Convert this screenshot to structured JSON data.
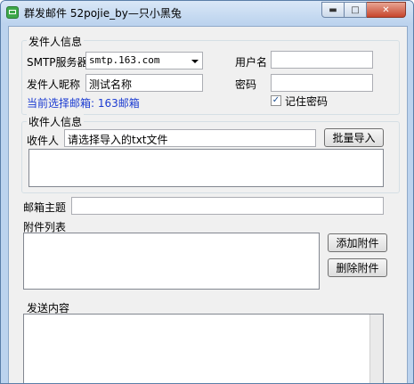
{
  "window": {
    "title": "群发邮件 52pojie_by—只小黑兔",
    "min_glyph": "▬",
    "max_glyph": "□",
    "close_glyph": "✕"
  },
  "sender": {
    "group_label": "发件人信息",
    "smtp_label": "SMTP服务器",
    "smtp_value": "smtp.163.com",
    "username_label": "用户名",
    "username_value": "",
    "nickname_label": "发件人昵称",
    "nickname_value": "测试名称",
    "password_label": "密码",
    "password_value": "",
    "remember_label": "记住密码",
    "remember_mark": "✓",
    "current_mail_text": "当前选择邮箱: 163邮箱"
  },
  "recipient": {
    "group_label": "收件人信息",
    "field_label": "收件人",
    "field_value": "请选择导入的txt文件",
    "import_button": "批量导入"
  },
  "mail": {
    "subject_label": "邮箱主题",
    "subject_value": "",
    "attachments_label": "附件列表",
    "add_attachment_button": "添加附件",
    "delete_attachment_button": "删除附件",
    "content_label": "发送内容"
  },
  "colors": {
    "accent_blue": "#1b3bd1"
  }
}
